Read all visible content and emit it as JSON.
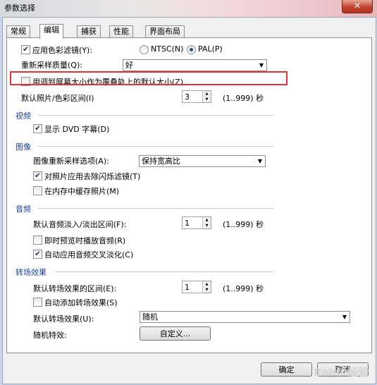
{
  "window": {
    "title": "参数选择",
    "close_glyph": "✕"
  },
  "tabs": [
    "常规",
    "编辑",
    "捕获",
    "性能",
    "界面布局"
  ],
  "active_tab": "编辑",
  "editing": {
    "color_filter": {
      "label": "应用色彩滤镜(Y):",
      "checked": true
    },
    "ntsc": {
      "label": "NTSC(N)",
      "selected": false
    },
    "pal": {
      "label": "PAL(P)",
      "selected": true
    },
    "resample_label": "重新采样质量(Q):",
    "resample_value": "好",
    "fit_overlay": {
      "label": "用调到屏幕大小作为覆叠轨上的默认大小(Z)",
      "checked": false
    },
    "photo_duration_label": "默认照片/色彩区间(I)",
    "photo_duration_value": "3",
    "photo_duration_range": "(1..999) 秒"
  },
  "video": {
    "section": "视频",
    "dvd_subtitles": {
      "label": "显示 DVD 字幕(D)",
      "checked": true
    }
  },
  "image": {
    "section": "图像",
    "resample_option_label": "图像重新采样选项(A):",
    "resample_option_value": "保持宽高比",
    "deflicker": {
      "label": "对照片应用去除闪烁滤镜(T)",
      "checked": true
    },
    "cache": {
      "label": "在内存中缓存照片(M)",
      "checked": false
    }
  },
  "audio": {
    "section": "音频",
    "fade_label": "默认音频淡入/淡出区间(F):",
    "fade_value": "1",
    "fade_range": "(1..999) 秒",
    "instant_play": {
      "label": "即时预览时播放音频(R)",
      "checked": false
    },
    "auto_crossfade": {
      "label": "自动应用音频交叉淡化(C)",
      "checked": true
    }
  },
  "transitions": {
    "section": "转场效果",
    "duration_label": "默认转场效果的区间(E):",
    "duration_value": "1",
    "duration_range": "(1..999) 秒",
    "auto_add": {
      "label": "自动添加转场效果(S)",
      "checked": false
    },
    "default_label": "默认转场效果(U):",
    "default_value": "随机",
    "random_label": "随机特效:",
    "customize_label": "自定义..."
  },
  "footer": {
    "ok": "确定",
    "cancel": "取消"
  },
  "watermark": "Baidu经验",
  "colors": {
    "highlight": "#e3342f",
    "section": "#1b3fa6"
  }
}
